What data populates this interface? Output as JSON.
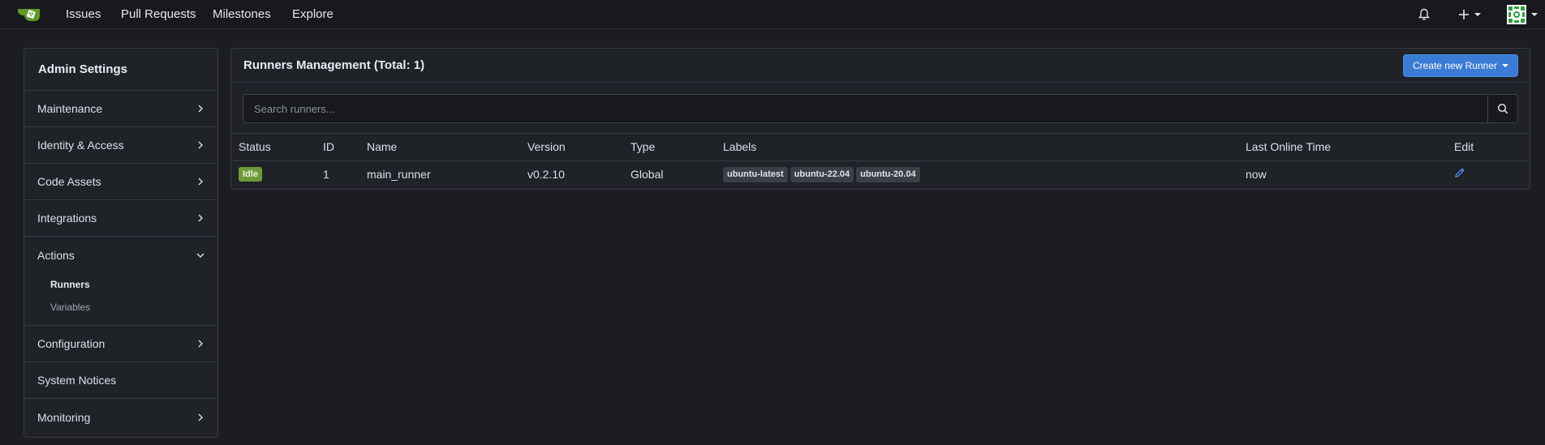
{
  "nav": {
    "links": [
      "Issues",
      "Pull Requests",
      "Milestones",
      "Explore"
    ]
  },
  "sidebar": {
    "title": "Admin Settings",
    "items": [
      {
        "label": "Maintenance"
      },
      {
        "label": "Identity & Access"
      },
      {
        "label": "Code Assets"
      },
      {
        "label": "Integrations"
      },
      {
        "label": "Actions",
        "expanded": true,
        "children": [
          {
            "label": "Runners",
            "active": true
          },
          {
            "label": "Variables"
          }
        ]
      },
      {
        "label": "Configuration"
      },
      {
        "label": "System Notices"
      },
      {
        "label": "Monitoring"
      }
    ]
  },
  "main": {
    "title": "Runners Management (Total: 1)",
    "create_button": "Create new Runner",
    "search_placeholder": "Search runners...",
    "columns": [
      "Status",
      "ID",
      "Name",
      "Version",
      "Type",
      "Labels",
      "Last Online Time",
      "Edit"
    ],
    "rows": [
      {
        "status": "Idle",
        "id": "1",
        "name": "main_runner",
        "version": "v0.2.10",
        "type": "Global",
        "labels": [
          "ubuntu-latest",
          "ubuntu-22.04",
          "ubuntu-20.04"
        ],
        "last_online": "now"
      }
    ]
  },
  "colors": {
    "accent": "#3a7bd5",
    "idle_badge": "#6f9a3a",
    "logo": "#609926"
  }
}
